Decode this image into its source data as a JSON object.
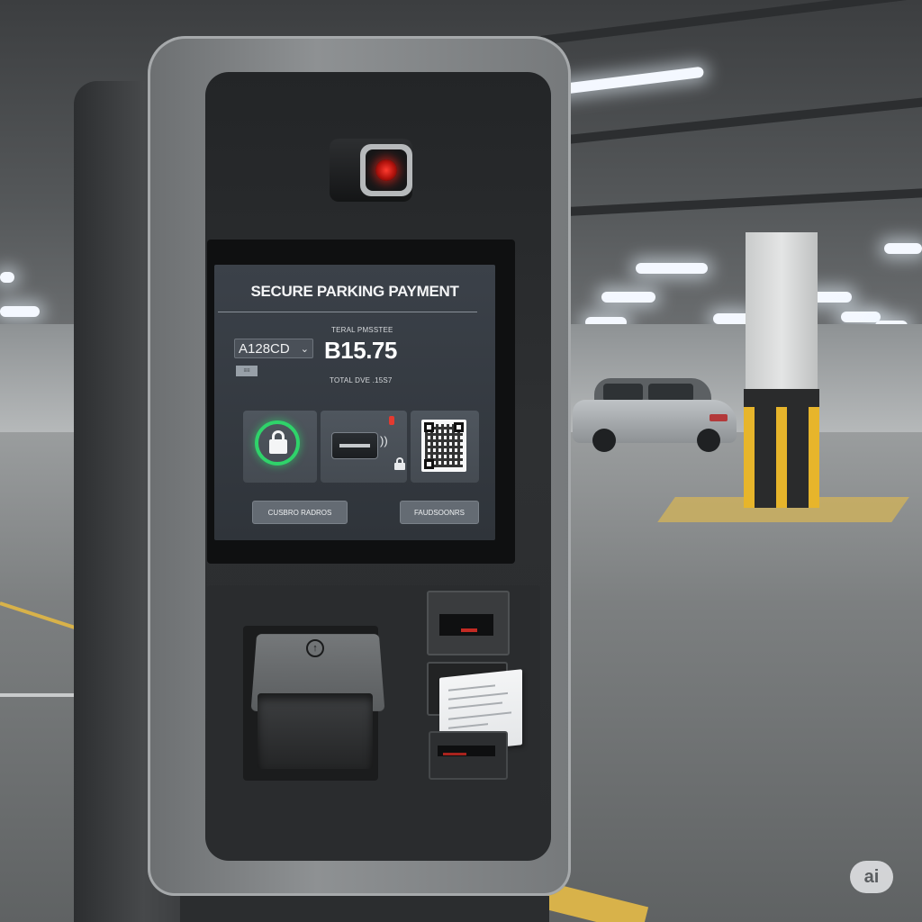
{
  "screen": {
    "title": "SECURE PARKING PAYMENT",
    "rate_label": "TERAL PMSSTEE",
    "plate": {
      "value": "A128CD",
      "chevron": "⌄"
    },
    "amount": "B15.75",
    "mini_tag": "≡≡",
    "total_due_label": "TOTAL DVE  .15S7",
    "payment_tiles": [
      {
        "icon": "padlock-icon",
        "ring_color": "#2fd36a"
      },
      {
        "icon": "card-reader-icon",
        "nfc": "))"
      },
      {
        "icon": "qr-code-icon"
      }
    ],
    "buttons": {
      "left": "CUSBRO RADROS",
      "right": "FAUDSOONRS"
    }
  },
  "hardware": {
    "flap_icon": "↑",
    "camera_led_color": "#ff3b30"
  },
  "watermark": "ai",
  "colors": {
    "accent_green": "#2fd36a",
    "alert_red": "#e43a30",
    "bollard_yellow": "#e7b52b"
  }
}
